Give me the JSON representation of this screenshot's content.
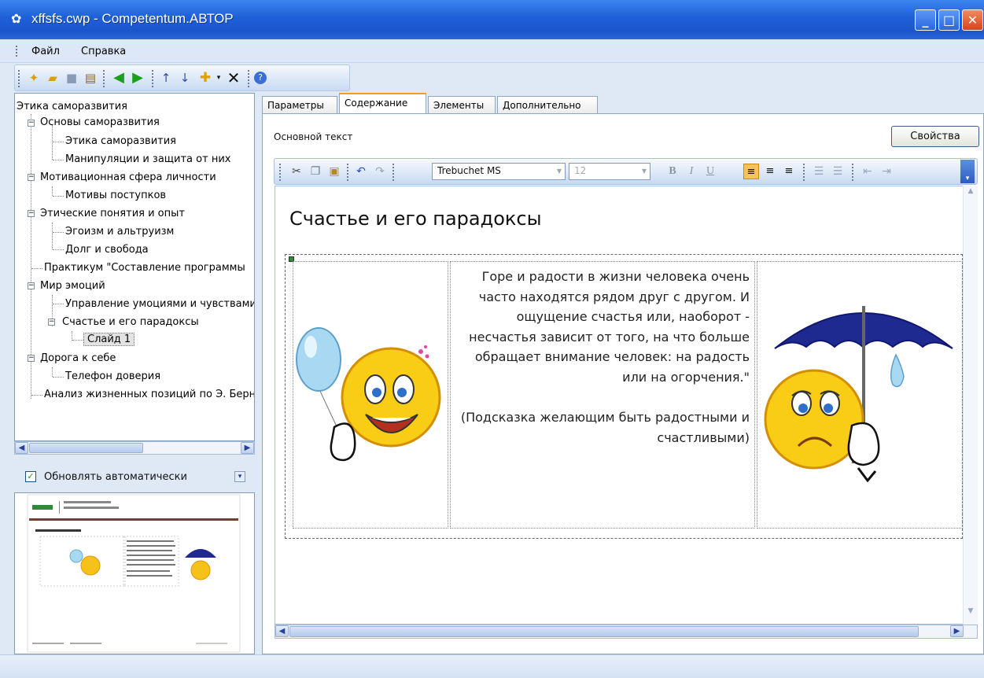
{
  "window": {
    "title": "xffsfs.cwp - Competentum.АВТОР"
  },
  "menu": {
    "items": [
      "Файл",
      "Справка"
    ]
  },
  "tree": {
    "root": "Этика саморазвития",
    "nodes": [
      "Основы саморазвития",
      "Этика саморазвития",
      "Манипуляции и защита от них",
      "Мотивационная сфера личности",
      "Мотивы поступков",
      "Этические понятия и опыт",
      "Эгоизм и альтруизм",
      "Долг и свобода",
      "Практикум \"Составление программы",
      "Мир эмоций",
      "Управление умоциями и чувствами",
      "Счастье и его парадоксы",
      "Слайд 1",
      "Дорога к себе",
      "Телефон доверия",
      "Анализ жизненных позиций по Э. Берну"
    ]
  },
  "auto_update": {
    "label": "Обновлять автоматически",
    "checked": true
  },
  "tabs": [
    "Параметры",
    "Содержание",
    "Элементы",
    "Дополнительно"
  ],
  "content": {
    "section_label": "Основной текст",
    "properties_button": "Свойства",
    "font_name": "Trebuchet MS",
    "font_size": "12",
    "heading": "Счастье и его парадоксы",
    "quote": "Горе и радости в жизни человека очень часто находятся рядом друг с другом. И ощущение счастья или, наоборот - несчастья зависит от того, на что больше обращает внимание человек: на радость или на огорчения.\"",
    "hint": "(Подсказка желающим быть радостными и счастливыми)"
  },
  "colors": {
    "titlebar": "#2462d8",
    "accent_tab": "#f0a020"
  }
}
